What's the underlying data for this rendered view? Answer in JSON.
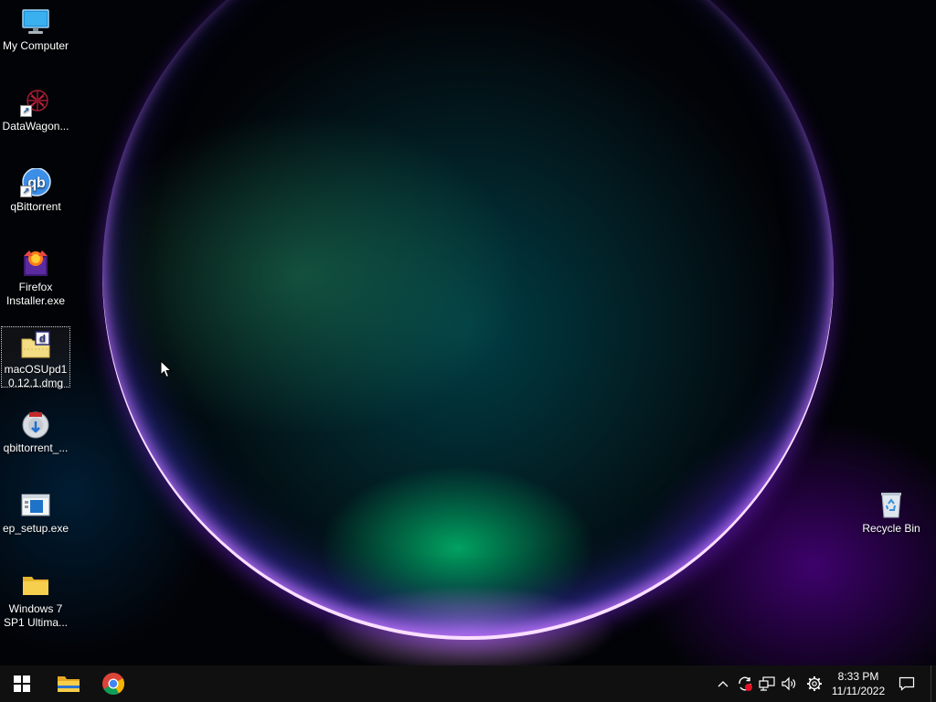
{
  "desktop": {
    "icons": [
      {
        "label": "My Computer",
        "icon": "monitor-icon"
      },
      {
        "label": "DataWagon...",
        "icon": "datawagon-icon"
      },
      {
        "label": "qBittorrent",
        "icon": "qbittorrent-icon"
      },
      {
        "label": "Firefox Installer.exe",
        "icon": "firefox-installer-icon"
      },
      {
        "label": "macOSUpd10.12.1.dmg",
        "icon": "dmg-file-icon"
      },
      {
        "label": "qbittorrent_...",
        "icon": "installer-disc-icon"
      },
      {
        "label": "ep_setup.exe",
        "icon": "setup-exe-icon"
      },
      {
        "label": "Windows 7 SP1 Ultima...",
        "icon": "folder-icon"
      },
      {
        "label": "Recycle Bin",
        "icon": "recycle-bin-icon"
      }
    ]
  },
  "taskbar": {
    "start_icon": "windows-start-icon",
    "pinned": [
      {
        "icon": "file-explorer-icon"
      },
      {
        "icon": "chrome-icon"
      }
    ],
    "tray": {
      "icons": [
        "chevron-up-icon",
        "sync-error-icon",
        "network-icon",
        "volume-icon",
        "settings-gear-icon"
      ]
    },
    "clock": {
      "time": "8:33 PM",
      "date": "11/11/2022"
    },
    "notification_icon": "notification-icon"
  },
  "colors": {
    "taskbar_bg": "#101010",
    "accent_blue": "#0078d7",
    "folder_yellow": "#f3c545"
  }
}
